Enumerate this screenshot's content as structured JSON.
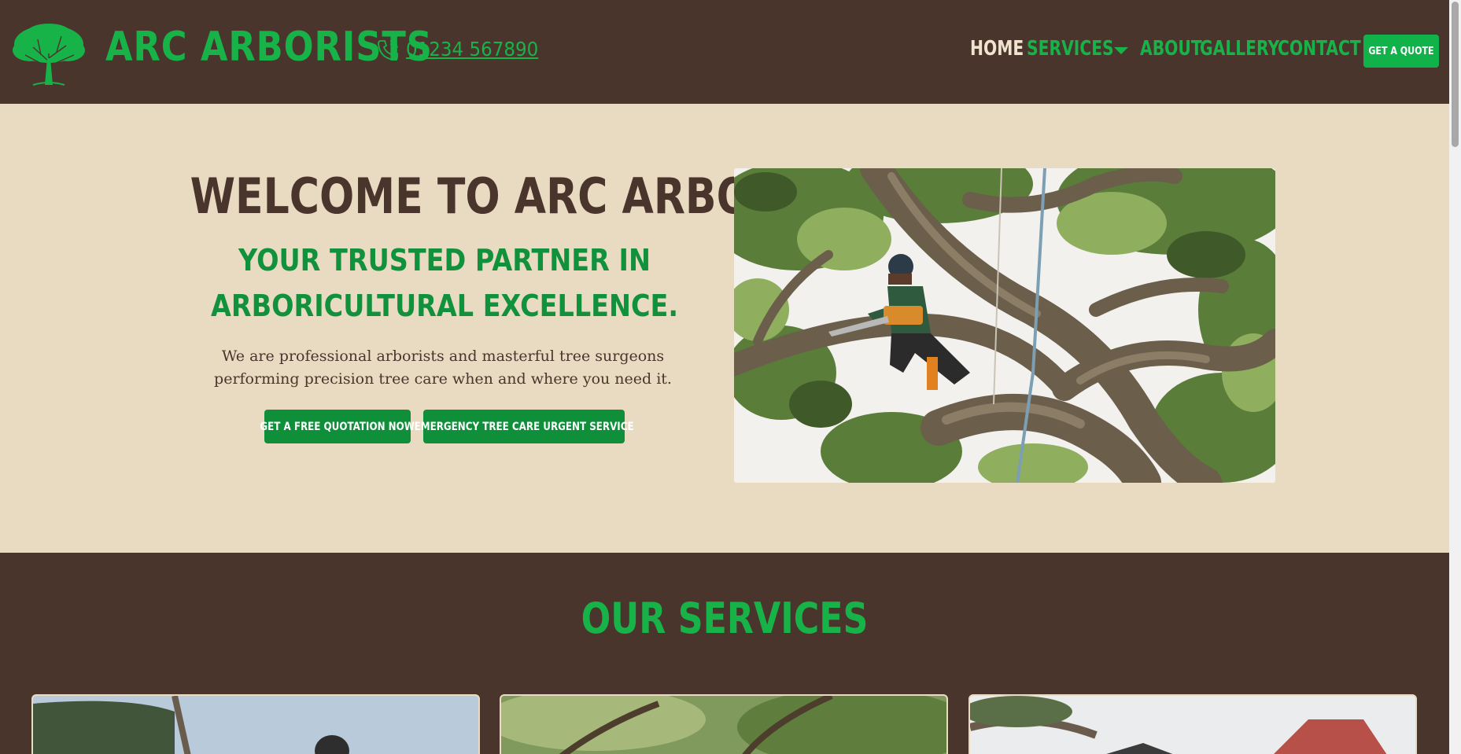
{
  "header": {
    "brand": "ARC ARBORISTS",
    "logo_icon": "oak-tree-icon",
    "phone_icon": "phone-icon",
    "phone": "01234 567890",
    "nav": [
      {
        "label": "HOME",
        "active": true
      },
      {
        "label": "SERVICES",
        "active": false,
        "dropdown": true
      },
      {
        "label": "ABOUT",
        "active": false
      },
      {
        "label": "GALLERY",
        "active": false
      },
      {
        "label": "CONTACT",
        "active": false
      }
    ],
    "cta": "GET A QUOTE"
  },
  "hero": {
    "title": "WELCOME TO ARC ARBORISTS",
    "subtitle": "YOUR TRUSTED PARTNER IN ARBORICULTURAL EXCELLENCE.",
    "description": "We are professional arborists and masterful tree surgeons performing precision tree care when and where you need it.",
    "buttons": [
      "GET A FREE QUOTATION NOW",
      "EMERGENCY TREE CARE URGENT SERVICE"
    ]
  },
  "services": {
    "title": "OUR SERVICES"
  },
  "colors": {
    "brown": "#4a352d",
    "cream": "#e9dbc2",
    "green": "#17b348",
    "dark_green": "#0f8f3a"
  }
}
